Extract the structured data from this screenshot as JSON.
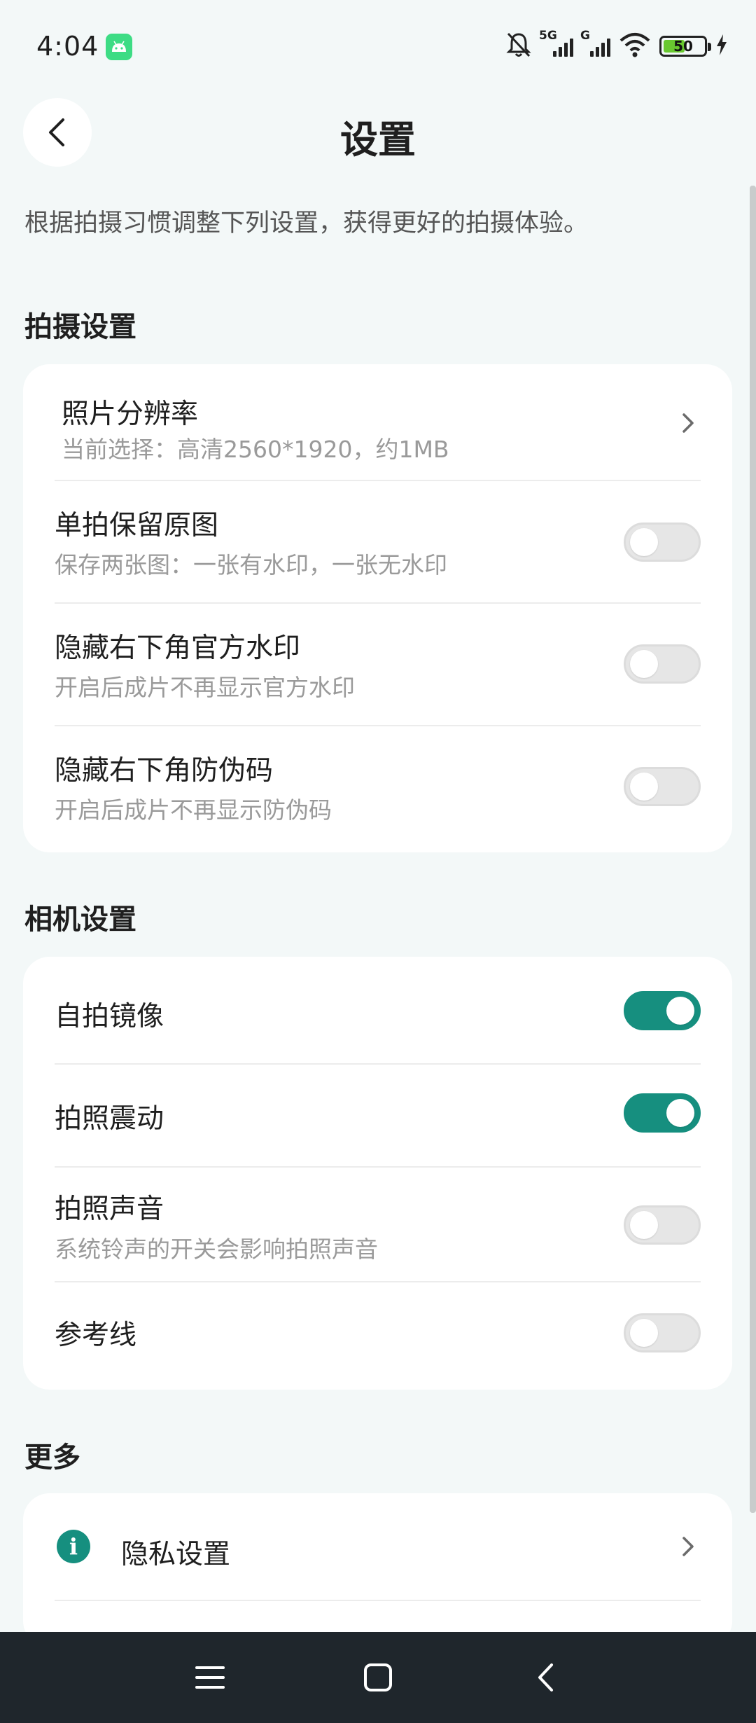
{
  "status_bar": {
    "time": "4:04",
    "network_1": "5G",
    "network_2": "G",
    "battery_level": "50",
    "icons": [
      "android-notification-icon",
      "silent-bell-icon",
      "signal-5g-icon",
      "signal-g-icon",
      "wifi-icon",
      "battery-icon",
      "charging-icon"
    ]
  },
  "header": {
    "title": "设置",
    "back_icon": "chevron-left-icon"
  },
  "intro": "根据拍摄习惯调整下列设置，获得更好的拍摄体验。",
  "sections": {
    "shooting": {
      "title": "拍摄设置",
      "resolution": {
        "title": "照片分辨率",
        "subtitle": "当前选择：高清2560*1920，约1MB"
      },
      "keep_original": {
        "title": "单拍保留原图",
        "subtitle": "保存两张图：一张有水印，一张无水印",
        "enabled": false
      },
      "hide_watermark": {
        "title": "隐藏右下角官方水印",
        "subtitle": "开启后成片不再显示官方水印",
        "enabled": false
      },
      "hide_anticounterfeit": {
        "title": "隐藏右下角防伪码",
        "subtitle": "开启后成片不再显示防伪码",
        "enabled": false
      }
    },
    "camera": {
      "title": "相机设置",
      "selfie_mirror": {
        "title": "自拍镜像",
        "enabled": true
      },
      "shutter_vibration": {
        "title": "拍照震动",
        "enabled": true
      },
      "shutter_sound": {
        "title": "拍照声音",
        "subtitle": "系统铃声的开关会影响拍照声音",
        "enabled": false
      },
      "grid_lines": {
        "title": "参考线",
        "enabled": false
      }
    },
    "more": {
      "title": "更多",
      "privacy": {
        "title": "隐私设置",
        "icon": "info-icon"
      }
    }
  },
  "colors": {
    "accent": "#168f7f",
    "background": "#f3f8f8",
    "card": "#ffffff",
    "nav_bar": "#1f262c",
    "battery_fill": "#69c830",
    "android_badge": "#3ddc84"
  },
  "nav_bar": {
    "icons": [
      "menu-icon",
      "home-icon",
      "back-icon"
    ]
  }
}
